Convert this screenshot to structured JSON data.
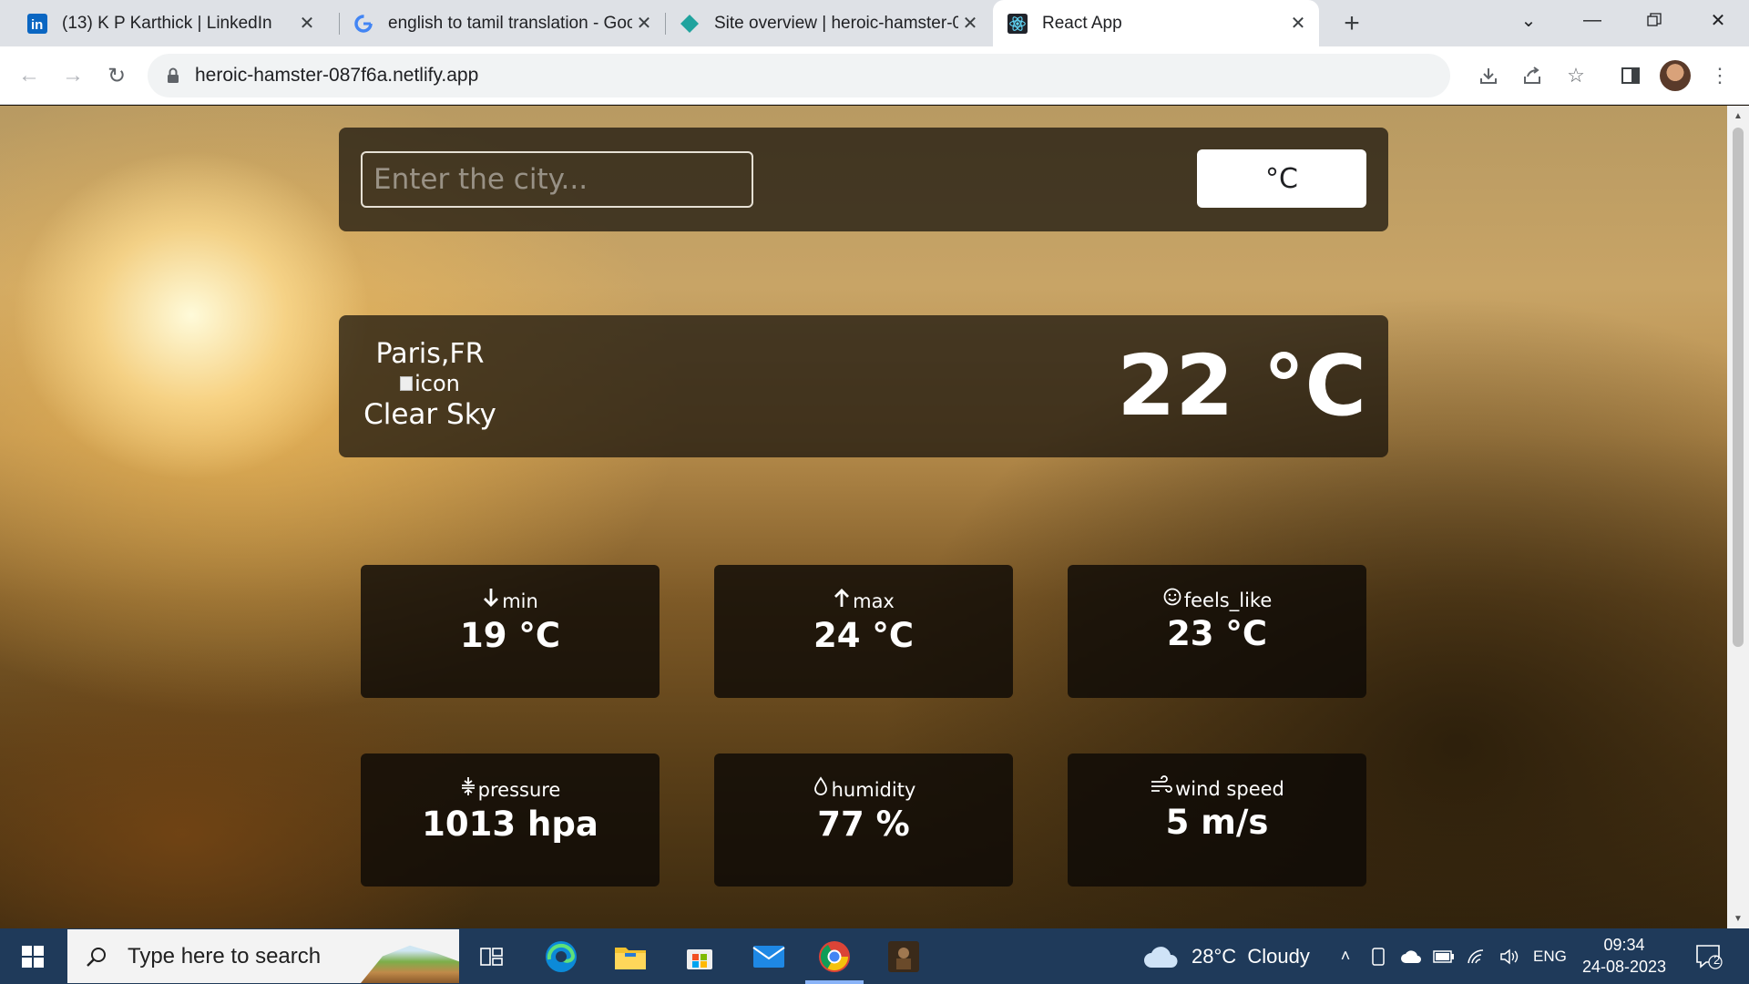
{
  "browser": {
    "tabs": [
      {
        "title": "(13) K P Karthick | LinkedIn",
        "active": false
      },
      {
        "title": "english to tamil translation - Goo",
        "active": false
      },
      {
        "title": "Site overview | heroic-hamster-0",
        "active": false
      },
      {
        "title": "React App",
        "active": true
      }
    ],
    "url": "heroic-hamster-087f6a.netlify.app"
  },
  "app": {
    "search": {
      "placeholder": "Enter the city...",
      "value": ""
    },
    "unit_button": "°C",
    "current": {
      "location": "Paris,FR",
      "icon_alt": "icon",
      "description": "Clear Sky",
      "temperature": "22 °C"
    },
    "details": [
      {
        "label": "min",
        "value": "19 °C",
        "icon": "arrow-down-icon"
      },
      {
        "label": "max",
        "value": "24 °C",
        "icon": "arrow-up-icon"
      },
      {
        "label": "feels_like",
        "value": "23 °C",
        "icon": "smile-icon"
      },
      {
        "label": "pressure",
        "value": "1013 hpa",
        "icon": "compress-icon"
      },
      {
        "label": "humidity",
        "value": "77 %",
        "icon": "droplet-icon"
      },
      {
        "label": "wind speed",
        "value": "5 m/s",
        "icon": "wind-icon"
      }
    ]
  },
  "taskbar": {
    "search_placeholder": "Type here to search",
    "weather": "28°C  Cloudy",
    "language": "ENG",
    "time": "09:34",
    "date": "24-08-2023",
    "notification_count": "2"
  }
}
